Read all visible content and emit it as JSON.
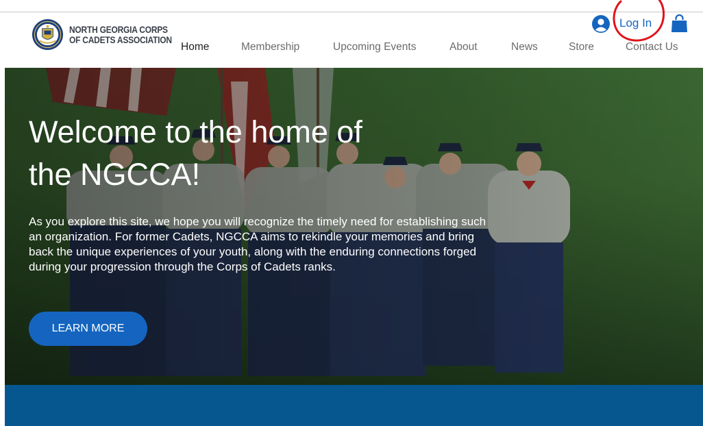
{
  "brand": {
    "line1": "NORTH GEORGIA CORPS",
    "line2": "OF CADETS ASSOCIATION",
    "logo_icon": "seal-logo-icon"
  },
  "nav": {
    "items": [
      {
        "label": "Home",
        "active": true
      },
      {
        "label": "Membership",
        "active": false
      },
      {
        "label": "Upcoming Events",
        "active": false
      },
      {
        "label": "About",
        "active": false
      },
      {
        "label": "News",
        "active": false
      },
      {
        "label": "Store",
        "active": false
      },
      {
        "label": "Contact Us",
        "active": false
      }
    ]
  },
  "account": {
    "login_label": "Log In",
    "user_icon": "user-avatar-icon",
    "cart_icon": "shopping-bag-icon"
  },
  "hero": {
    "title_line1": "Welcome to the home of",
    "title_line2": "the NGCCA!",
    "body": "As you explore this site, we hope you will recognize the timely need for establishing such an organization. For former Cadets, NGCCA aims to rekindle your memories and bring back the unique experiences of your youth, along with the enduring connections forged during your progression through the Corps of Cadets ranks.",
    "cta_label": "LEARN MORE"
  },
  "colors": {
    "accent": "#1565c0",
    "band": "#06578f",
    "annotation": "#e0121a"
  }
}
